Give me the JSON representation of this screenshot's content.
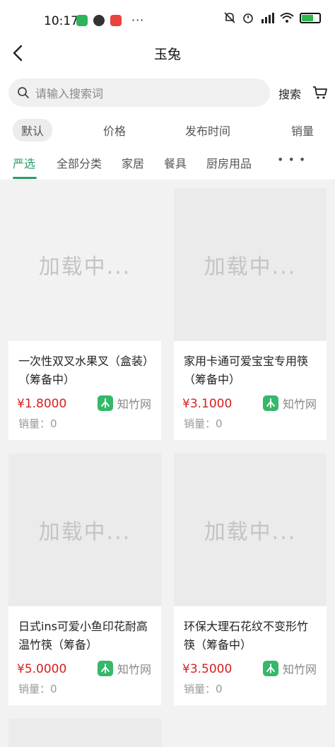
{
  "status_bar": {
    "time": "10:17",
    "dots": "···"
  },
  "header": {
    "title": "玉兔"
  },
  "search": {
    "placeholder": "请输入搜索词",
    "button_label": "搜索"
  },
  "sort_tabs": [
    {
      "label": "默认",
      "active": true
    },
    {
      "label": "价格",
      "active": false
    },
    {
      "label": "发布时间",
      "active": false
    },
    {
      "label": "销量",
      "active": false
    }
  ],
  "category_tabs": [
    {
      "label": "严选",
      "active": true
    },
    {
      "label": "全部分类",
      "active": false
    },
    {
      "label": "家居",
      "active": false
    },
    {
      "label": "餐具",
      "active": false
    },
    {
      "label": "厨房用品",
      "active": false
    }
  ],
  "products": [
    {
      "image_text": "加载中...",
      "title": "一次性双叉水果叉（盒装）（筹备中）",
      "price": "¥1.8000",
      "source": "知竹网",
      "sales": "销量：0"
    },
    {
      "image_text": "加载中...",
      "title": "家用卡通可爱宝宝专用筷（筹备中）",
      "price": "¥3.1000",
      "source": "知竹网",
      "sales": "销量：0"
    },
    {
      "image_text": "加载中...",
      "title": "日式ins可爱小鱼印花耐高温竹筷（筹备）",
      "price": "¥5.0000",
      "source": "知竹网",
      "sales": "销量：0"
    },
    {
      "image_text": "加载中...",
      "title": "环保大理石花纹不变形竹筷（筹备中）",
      "price": "¥3.5000",
      "source": "知竹网",
      "sales": "销量：0"
    }
  ],
  "colors": {
    "accent": "#2e9b6a",
    "price": "#d81e1e",
    "source_icon": "#35b86a"
  }
}
